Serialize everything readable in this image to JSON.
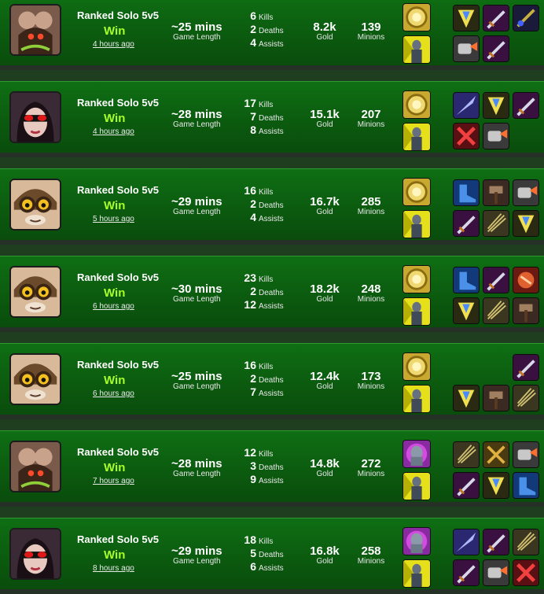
{
  "labels": {
    "game_length": "Game Length",
    "kills": "Kills",
    "deaths": "Deaths",
    "assists": "Assists",
    "gold": "Gold",
    "minions": "Minions"
  },
  "matches": [
    {
      "champion_icon": "champion-portrait-beast",
      "queue": "Ranked Solo 5v5",
      "result": "Win",
      "ago": "4 hours ago",
      "length": "~25 mins",
      "kills": "6",
      "deaths": "2",
      "assists": "4",
      "gold": "8.2k",
      "minions": "139",
      "spells": [
        "flash-spell-icon",
        "ghost-spell-icon"
      ],
      "items": [
        "amulet-item-icon",
        "sword-item-icon",
        "dagger-item-icon",
        "gauntlet-item-icon",
        "sword-item-icon"
      ]
    },
    {
      "champion_icon": "champion-portrait-goggles-girl",
      "queue": "Ranked Solo 5v5",
      "result": "Win",
      "ago": "4 hours ago",
      "length": "~28 mins",
      "kills": "17",
      "deaths": "7",
      "assists": "8",
      "gold": "15.1k",
      "minions": "207",
      "spells": [
        "flash-spell-icon",
        "ghost-spell-icon"
      ],
      "items": [
        "blade-item-icon",
        "amulet-item-icon",
        "sword-item-icon",
        "bow-item-icon",
        "gauntlet-item-icon"
      ]
    },
    {
      "champion_icon": "champion-portrait-yordle",
      "queue": "Ranked Solo 5v5",
      "result": "Win",
      "ago": "5 hours ago",
      "length": "~29 mins",
      "kills": "16",
      "deaths": "2",
      "assists": "4",
      "gold": "16.7k",
      "minions": "285",
      "spells": [
        "flash-spell-icon",
        "ghost-spell-icon"
      ],
      "items": [
        "boots-item-icon",
        "hammer-item-icon",
        "gauntlet-item-icon",
        "sword-item-icon",
        "claw-item-icon",
        "amulet-item-icon"
      ]
    },
    {
      "champion_icon": "champion-portrait-yordle",
      "queue": "Ranked Solo 5v5",
      "result": "Win",
      "ago": "6 hours ago",
      "length": "~30 mins",
      "kills": "23",
      "deaths": "2",
      "assists": "12",
      "gold": "18.2k",
      "minions": "248",
      "spells": [
        "flash-spell-icon",
        "ghost-spell-icon"
      ],
      "items": [
        "boots-item-icon",
        "sword-item-icon",
        "fist-item-icon",
        "amulet-item-icon",
        "claw-item-icon",
        "hammer-item-icon"
      ]
    },
    {
      "champion_icon": "champion-portrait-yordle",
      "queue": "Ranked Solo 5v5",
      "result": "Win",
      "ago": "6 hours ago",
      "length": "~25 mins",
      "kills": "16",
      "deaths": "2",
      "assists": "7",
      "gold": "12.4k",
      "minions": "173",
      "spells": [
        "flash-spell-icon",
        "ghost-spell-icon"
      ],
      "items": [
        "sword-item-icon",
        "amulet-item-icon",
        "hammer-item-icon",
        "claw-item-icon"
      ]
    },
    {
      "champion_icon": "champion-portrait-beast",
      "queue": "Ranked Solo 5v5",
      "result": "Win",
      "ago": "7 hours ago",
      "length": "~28 mins",
      "kills": "12",
      "deaths": "3",
      "assists": "9",
      "gold": "14.8k",
      "minions": "272",
      "spells": [
        "cleanse-spell-icon",
        "ghost-spell-icon"
      ],
      "items": [
        "claw-item-icon",
        "crossed-blades-item-icon",
        "gauntlet-item-icon",
        "sword-item-icon",
        "amulet-item-icon",
        "boots-item-icon"
      ]
    },
    {
      "champion_icon": "champion-portrait-goggles-girl",
      "queue": "Ranked Solo 5v5",
      "result": "Win",
      "ago": "8 hours ago",
      "length": "~29 mins",
      "kills": "18",
      "deaths": "5",
      "assists": "6",
      "gold": "16.8k",
      "minions": "258",
      "spells": [
        "cleanse-spell-icon",
        "ghost-spell-icon"
      ],
      "items": [
        "blade-item-icon",
        "sword-item-icon",
        "claw-item-icon",
        "sword-item-icon",
        "gauntlet-item-icon",
        "bow-item-icon"
      ]
    }
  ]
}
